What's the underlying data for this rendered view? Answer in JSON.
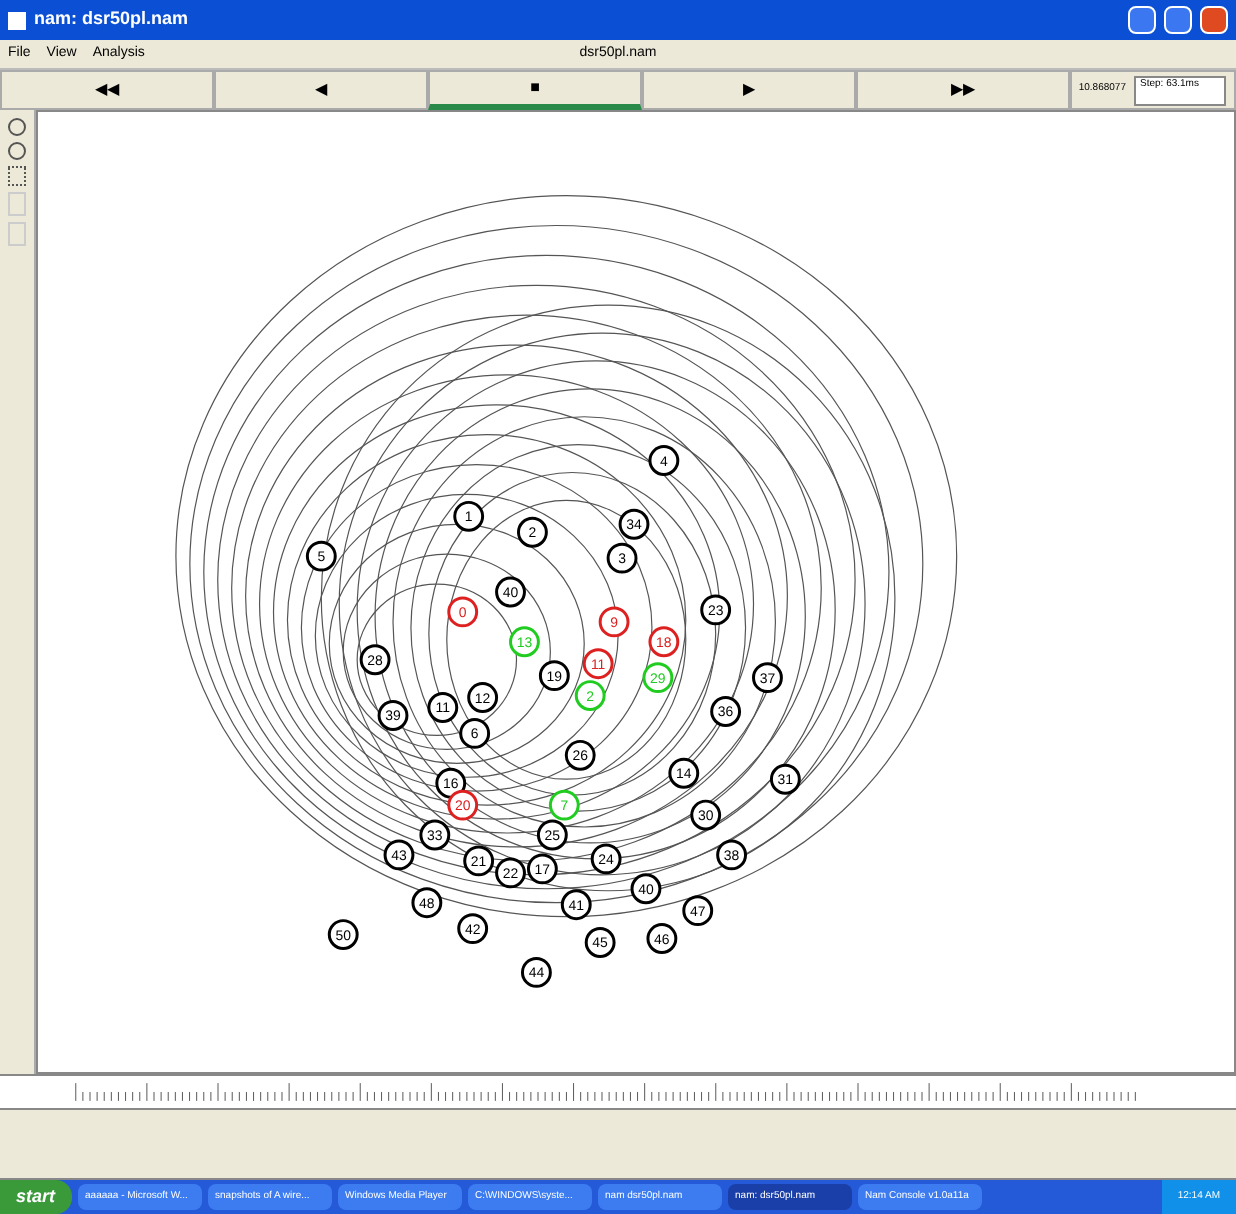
{
  "window": {
    "title": "nam: dsr50pl.nam"
  },
  "menu": [
    "File",
    "View",
    "Analysis"
  ],
  "file_name": "dsr50pl.nam",
  "controls": [
    {
      "label": "◀◀",
      "selected": false
    },
    {
      "label": "◀",
      "selected": false
    },
    {
      "label": "■",
      "selected": true
    },
    {
      "label": "▶",
      "selected": false
    },
    {
      "label": "▶▶",
      "selected": false
    }
  ],
  "time": "10.868077",
  "step": "Step: 63.1ms",
  "nodes": [
    {
      "label": "4",
      "color": "#000000"
    },
    {
      "label": "1",
      "color": "#000000"
    },
    {
      "label": "2",
      "color": "#000000"
    },
    {
      "label": "34",
      "color": "#000000"
    },
    {
      "label": "5",
      "color": "#000000"
    },
    {
      "label": "3",
      "color": "#000000"
    },
    {
      "label": "40",
      "color": "#000000"
    },
    {
      "label": "0",
      "color": "#dd2020"
    },
    {
      "label": "9",
      "color": "#dd2020"
    },
    {
      "label": "23",
      "color": "#000000"
    },
    {
      "label": "13",
      "color": "#20cc20"
    },
    {
      "label": "18",
      "color": "#dd2020"
    },
    {
      "label": "28",
      "color": "#000000"
    },
    {
      "label": "19",
      "color": "#000000"
    },
    {
      "label": "11",
      "color": "#dd2020"
    },
    {
      "label": "29",
      "color": "#20cc20"
    },
    {
      "label": "37",
      "color": "#000000"
    },
    {
      "label": "39",
      "color": "#000000"
    },
    {
      "label": "11",
      "color": "#000000"
    },
    {
      "label": "12",
      "color": "#000000"
    },
    {
      "label": "2",
      "color": "#20cc20"
    },
    {
      "label": "36",
      "color": "#000000"
    },
    {
      "label": "6",
      "color": "#000000"
    },
    {
      "label": "26",
      "color": "#000000"
    },
    {
      "label": "16",
      "color": "#000000"
    },
    {
      "label": "14",
      "color": "#000000"
    },
    {
      "label": "31",
      "color": "#000000"
    },
    {
      "label": "20",
      "color": "#dd2020"
    },
    {
      "label": "7",
      "color": "#20cc20"
    },
    {
      "label": "30",
      "color": "#000000"
    },
    {
      "label": "33",
      "color": "#000000"
    },
    {
      "label": "25",
      "color": "#000000"
    },
    {
      "label": "43",
      "color": "#000000"
    },
    {
      "label": "21",
      "color": "#000000"
    },
    {
      "label": "22",
      "color": "#000000"
    },
    {
      "label": "17",
      "color": "#000000"
    },
    {
      "label": "24",
      "color": "#000000"
    },
    {
      "label": "38",
      "color": "#000000"
    },
    {
      "label": "40",
      "color": "#000000"
    },
    {
      "label": "48",
      "color": "#000000"
    },
    {
      "label": "41",
      "color": "#000000"
    },
    {
      "label": "47",
      "color": "#000000"
    },
    {
      "label": "50",
      "color": "#000000"
    },
    {
      "label": "42",
      "color": "#000000"
    },
    {
      "label": "45",
      "color": "#000000"
    },
    {
      "label": "46",
      "color": "#000000"
    },
    {
      "label": "44",
      "color": "#000000"
    }
  ],
  "taskbar": {
    "start": "start",
    "items": [
      {
        "label": "aaaaaa - Microsoft W...",
        "selected": false
      },
      {
        "label": "snapshots of A wire...",
        "selected": false
      },
      {
        "label": "Windows Media Player",
        "selected": false
      },
      {
        "label": "C:\\WINDOWS\\syste...",
        "selected": false
      },
      {
        "label": "nam dsr50pl.nam",
        "selected": false
      },
      {
        "label": "nam: dsr50pl.nam",
        "selected": true
      },
      {
        "label": "Nam Console v1.0a11a",
        "selected": false
      }
    ],
    "clock": "12:14 AM"
  }
}
